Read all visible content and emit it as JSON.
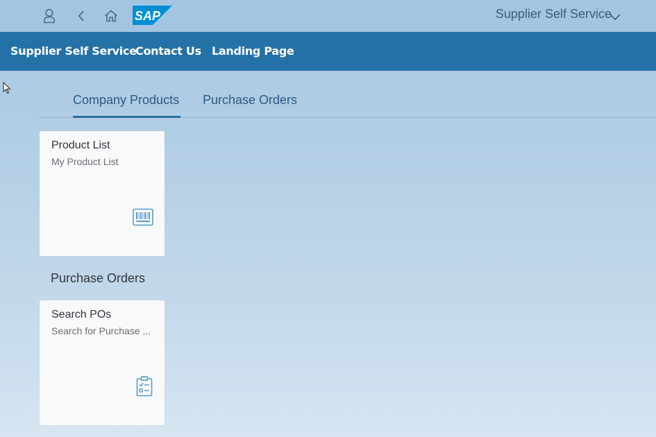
{
  "shell": {
    "title": "Supplier Self Service",
    "logo_text": "SAP",
    "icons": [
      "user-icon",
      "back-icon",
      "home-icon",
      "chevron-down-icon"
    ]
  },
  "navbar": {
    "links": [
      "Supplier Self Service",
      "Contact Us",
      "Landing Page"
    ]
  },
  "anchor_bar": {
    "tabs": [
      "Company Products",
      "Purchase Orders"
    ],
    "active_tab": "Company Products"
  },
  "sections": [
    {
      "title": "",
      "tiles": [
        {
          "title": "Product List",
          "subtitle": "My Product List",
          "icon": "barcode-icon"
        }
      ]
    },
    {
      "title": "Purchase Orders",
      "tiles": [
        {
          "title": "Search POs",
          "subtitle": "Search for Purchase ...",
          "icon": "clipboard-checklist-icon"
        }
      ]
    }
  ],
  "colors": {
    "navbar_bg": "#2471a7",
    "shellbar_bg": "#a3c5e1",
    "tile_bg": "#f8f9fa",
    "accent": "#2a6e9c",
    "icon_blue": "#5a9ac6",
    "sap_blue": "#008fd3"
  }
}
